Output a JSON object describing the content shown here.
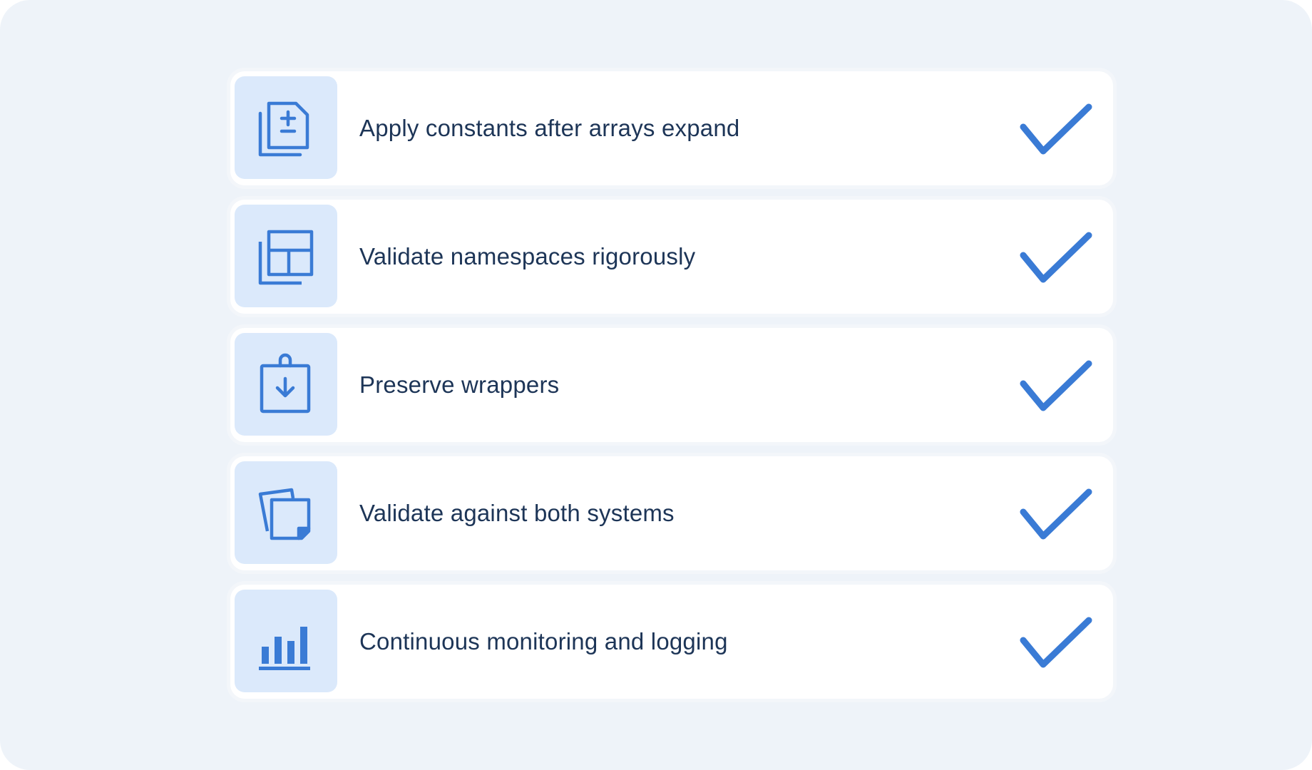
{
  "checklist": {
    "accent_color": "#3a7bd5",
    "items": [
      {
        "label": "Apply constants after arrays expand",
        "icon": "file-plus-minus-icon",
        "status": "checked"
      },
      {
        "label": "Validate namespaces rigorously",
        "icon": "layout-copy-icon",
        "status": "checked"
      },
      {
        "label": "Preserve wrappers",
        "icon": "clipboard-download-icon",
        "status": "checked"
      },
      {
        "label": "Validate against both systems",
        "icon": "notes-stack-icon",
        "status": "checked"
      },
      {
        "label": "Continuous monitoring and logging",
        "icon": "bar-chart-icon",
        "status": "checked"
      }
    ]
  }
}
